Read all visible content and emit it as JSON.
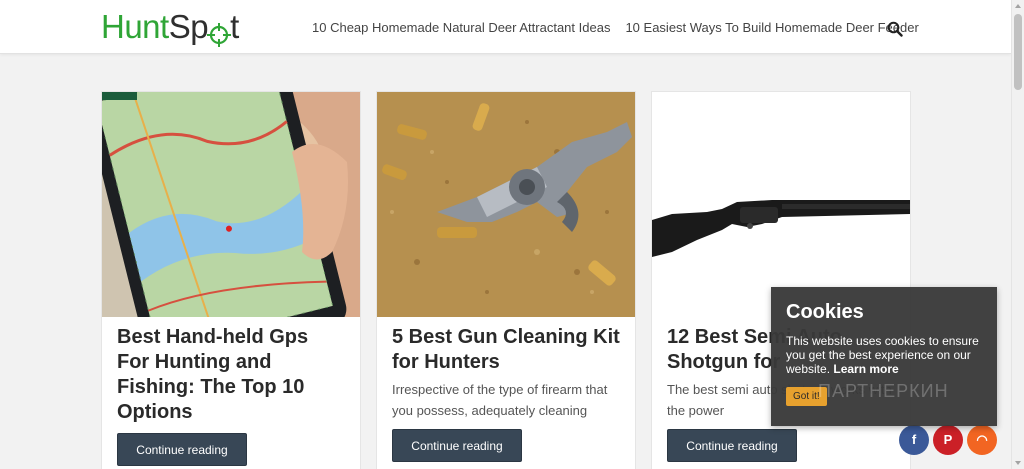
{
  "header": {
    "logo_hunt": "Hunt",
    "logo_sp": "Sp",
    "logo_t": "t",
    "nav": [
      {
        "label": "10 Cheap Homemade Natural Deer Attractant Ideas"
      },
      {
        "label": "10 Easiest Ways To Build Homemade Deer Feeder"
      }
    ],
    "search_icon": "search-icon"
  },
  "cards": [
    {
      "title": "Best Hand-held Gps For Hunting and Fishing: The Top 10 Options",
      "excerpt": "",
      "button": "Continue reading",
      "image": "gps-map-phone"
    },
    {
      "title": "5 Best Gun Cleaning Kit for Hunters",
      "excerpt": "Irrespective of the type of firearm that you possess, adequately cleaning",
      "button": "Continue reading",
      "image": "revolver-on-sand"
    },
    {
      "title": "12 Best Semi Auto Shotgun for",
      "excerpt": "The best semi auto shotgun works with the power",
      "button": "Continue reading",
      "image": "black-shotgun"
    }
  ],
  "cookie": {
    "title": "Cookies",
    "text": "This website uses cookies to ensure you get the best experience on our website.",
    "learn_more": "Learn more",
    "button": "Got it!"
  },
  "watermark": "ПАРТНЕРКИН",
  "social": [
    {
      "icon": "facebook-icon",
      "glyph": "f",
      "color": "#3b5998"
    },
    {
      "icon": "pinterest-icon",
      "glyph": "P",
      "color": "#cb2027"
    },
    {
      "icon": "rss-icon",
      "glyph": "◠",
      "color": "#f26522"
    }
  ],
  "colors": {
    "brand_green": "#2fa536",
    "button": "#384756",
    "cookie_bg": "#393939",
    "cookie_btn": "#e7a12e"
  }
}
